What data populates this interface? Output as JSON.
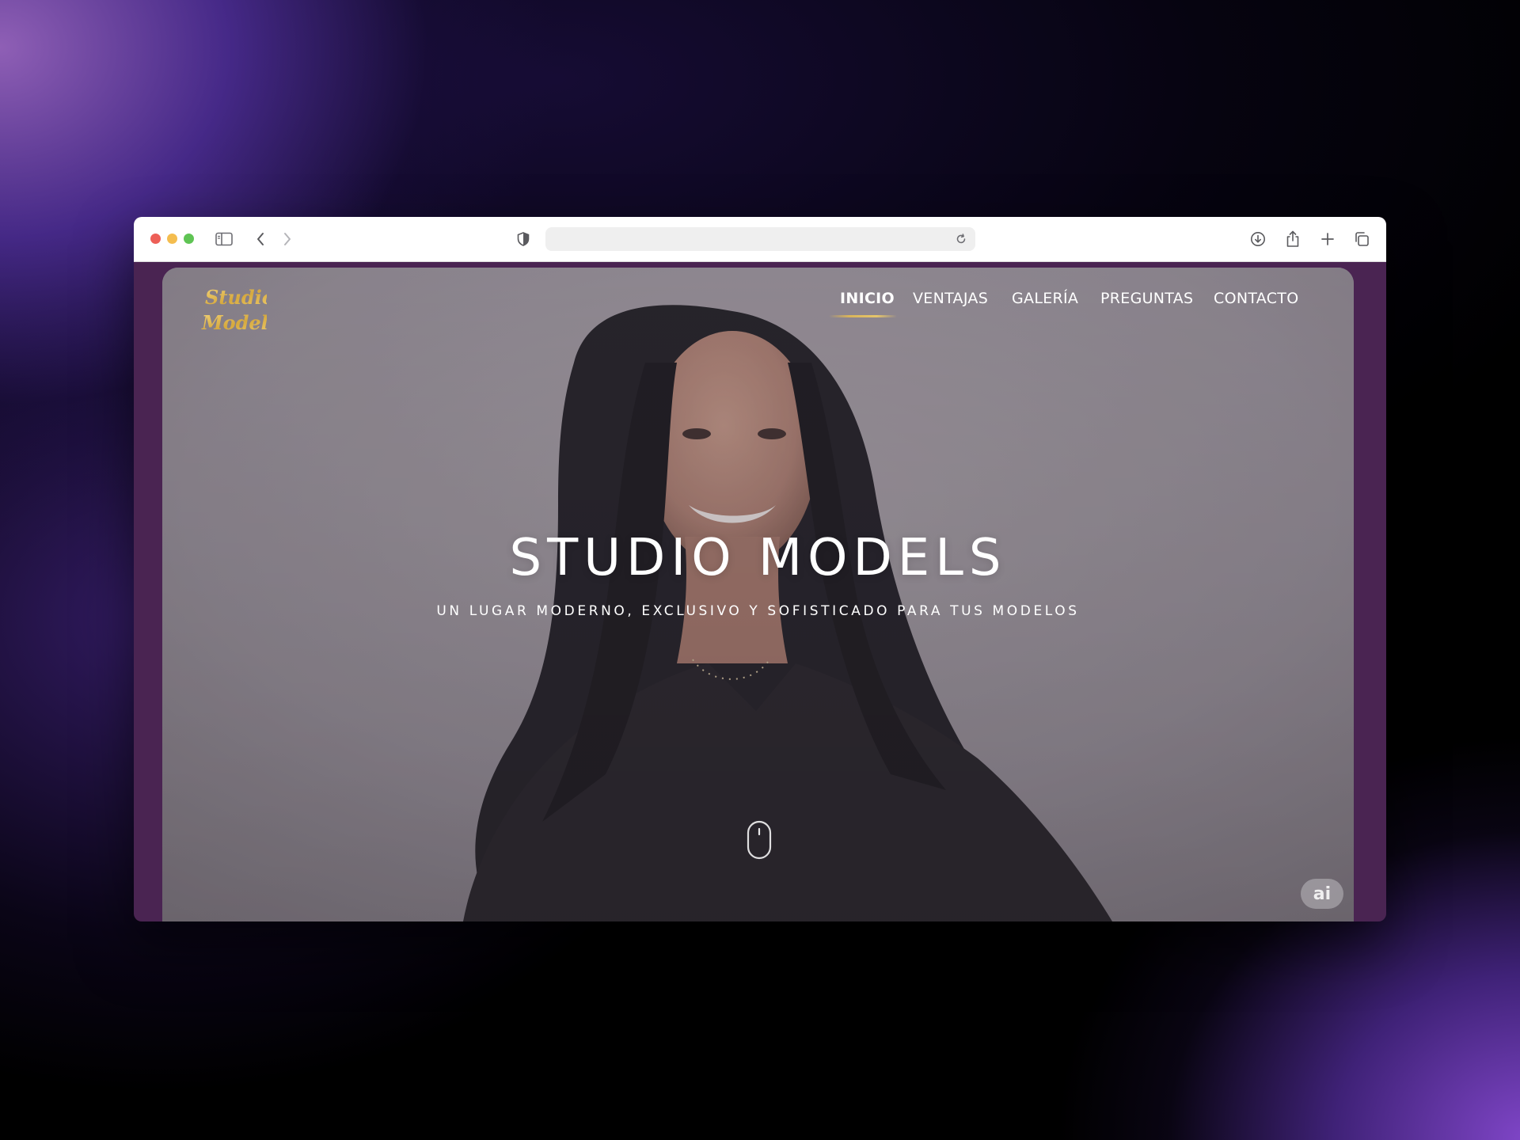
{
  "brand": {
    "logo_line1": "Studio",
    "logo_line2": "Models"
  },
  "nav": {
    "items": [
      {
        "label": "INICIO",
        "active": true
      },
      {
        "label": "VENTAJAS",
        "active": false
      },
      {
        "label": "GALERÍA",
        "active": false
      },
      {
        "label": "PREGUNTAS",
        "active": false
      },
      {
        "label": "CONTACTO",
        "active": false
      }
    ]
  },
  "hero": {
    "title": "STUDIO MODELS",
    "subtitle": "UN LUGAR MODERNO, EXCLUSIVO Y SOFISTICADO PARA TUS MODELOS",
    "scroll_icon": "mouse-scroll-icon"
  },
  "badge": {
    "label": "ai"
  },
  "browser": {
    "url": "",
    "icons": [
      "sidebar-icon",
      "back-icon",
      "forward-icon",
      "shield-icon",
      "reload-icon",
      "download-icon",
      "share-icon",
      "new-tab-icon",
      "tabs-overview-icon"
    ]
  },
  "colors": {
    "page_frame": "#4a2452",
    "gold": "#d9b45a",
    "hero_overlay": "#8f8b8e",
    "text": "#ffffff"
  }
}
